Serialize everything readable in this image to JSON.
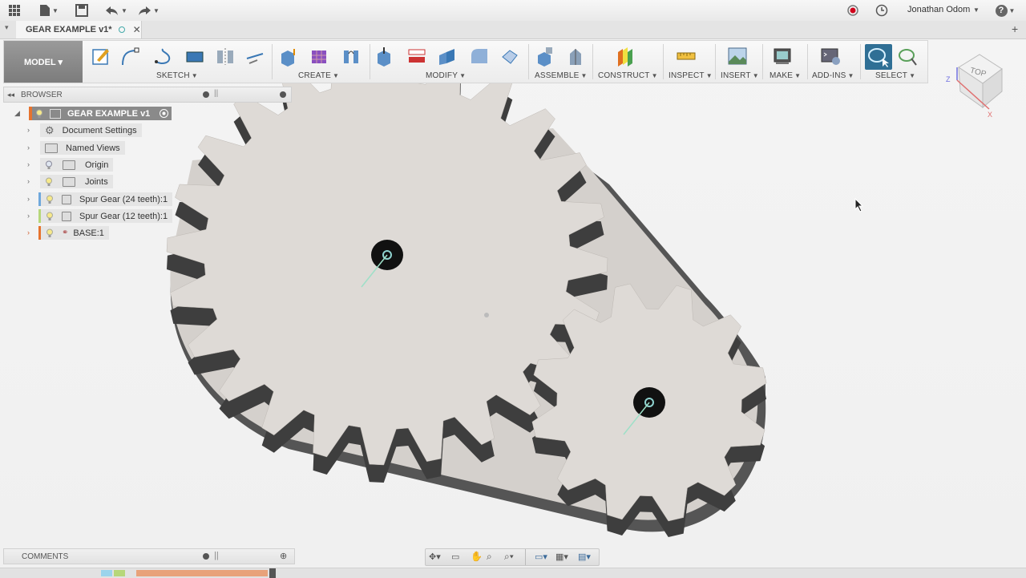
{
  "app": {
    "user": "Jonathan Odom",
    "help": "?"
  },
  "tab": {
    "title": "GEAR EXAMPLE v1*"
  },
  "toolbar": {
    "workspace": "MODEL ▾",
    "groups": [
      "SKETCH",
      "CREATE",
      "MODIFY",
      "ASSEMBLE",
      "CONSTRUCT",
      "INSPECT",
      "INSERT",
      "MAKE",
      "ADD-INS",
      "SELECT"
    ]
  },
  "viewcube": {
    "face": "TOP",
    "axis_z": "Z",
    "axis_x": "X"
  },
  "browser": {
    "title": "BROWSER",
    "root": "GEAR EXAMPLE v1",
    "items": [
      {
        "label": "Document Settings"
      },
      {
        "label": "Named Views"
      },
      {
        "label": "Origin"
      },
      {
        "label": "Joints"
      },
      {
        "label": "Spur Gear (24 teeth):1"
      },
      {
        "label": "Spur Gear (12 teeth):1"
      },
      {
        "label": "BASE:1"
      }
    ]
  },
  "comments": {
    "title": "COMMENTS"
  },
  "colors": {
    "accent_select": "#2f6f95",
    "gear_face": "#dedad6",
    "gear_side": "#4a4a4a",
    "record": "#d0021b"
  }
}
